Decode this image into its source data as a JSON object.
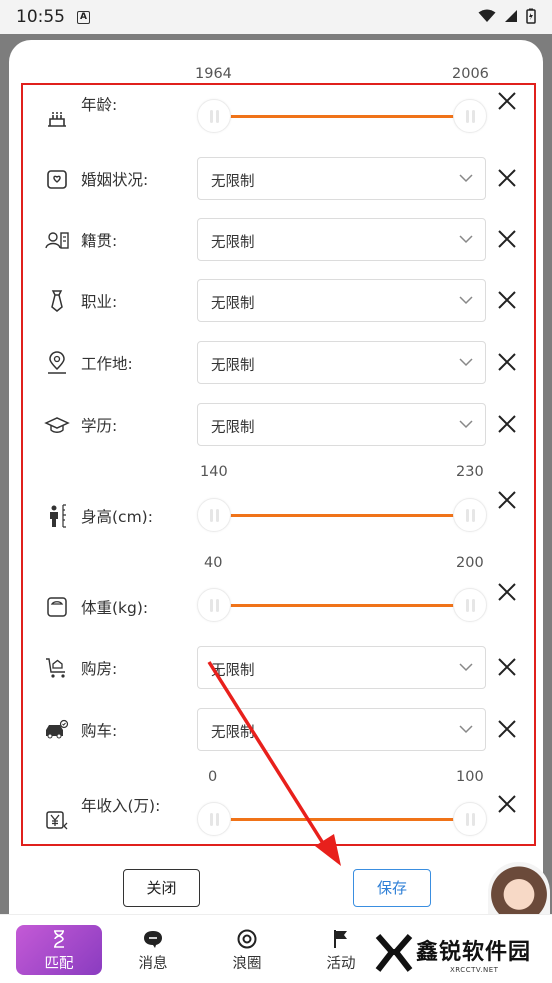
{
  "status": {
    "time": "10:55"
  },
  "filters": {
    "age": {
      "label": "年龄:",
      "min": "1964",
      "max": "2006"
    },
    "marital": {
      "label": "婚姻状况:",
      "value": "无限制"
    },
    "hometown": {
      "label": "籍贯:",
      "value": "无限制"
    },
    "occupation": {
      "label": "职业:",
      "value": "无限制"
    },
    "workplace": {
      "label": "工作地:",
      "value": "无限制"
    },
    "education": {
      "label": "学历:",
      "value": "无限制"
    },
    "height": {
      "label": "身高(cm):",
      "min": "140",
      "max": "230"
    },
    "weight": {
      "label": "体重(kg):",
      "min": "40",
      "max": "200"
    },
    "house": {
      "label": "购房:",
      "value": "无限制"
    },
    "car": {
      "label": "购车:",
      "value": "无限制"
    },
    "income": {
      "label": "年收入(万):",
      "min": "0",
      "max": "100"
    }
  },
  "actions": {
    "close_label": "关闭",
    "save_label": "保存"
  },
  "nav": {
    "items": [
      {
        "label": "匹配"
      },
      {
        "label": "消息"
      },
      {
        "label": "浪圈"
      },
      {
        "label": "活动"
      }
    ]
  },
  "watermark": {
    "title": "鑫锐软件园",
    "subtitle": "XRCCTV.NET"
  },
  "colors": {
    "accent": "#f07318",
    "highlight": "#e0201c",
    "save_blue": "#2e7fd6",
    "nav_active": "#a048c8"
  }
}
